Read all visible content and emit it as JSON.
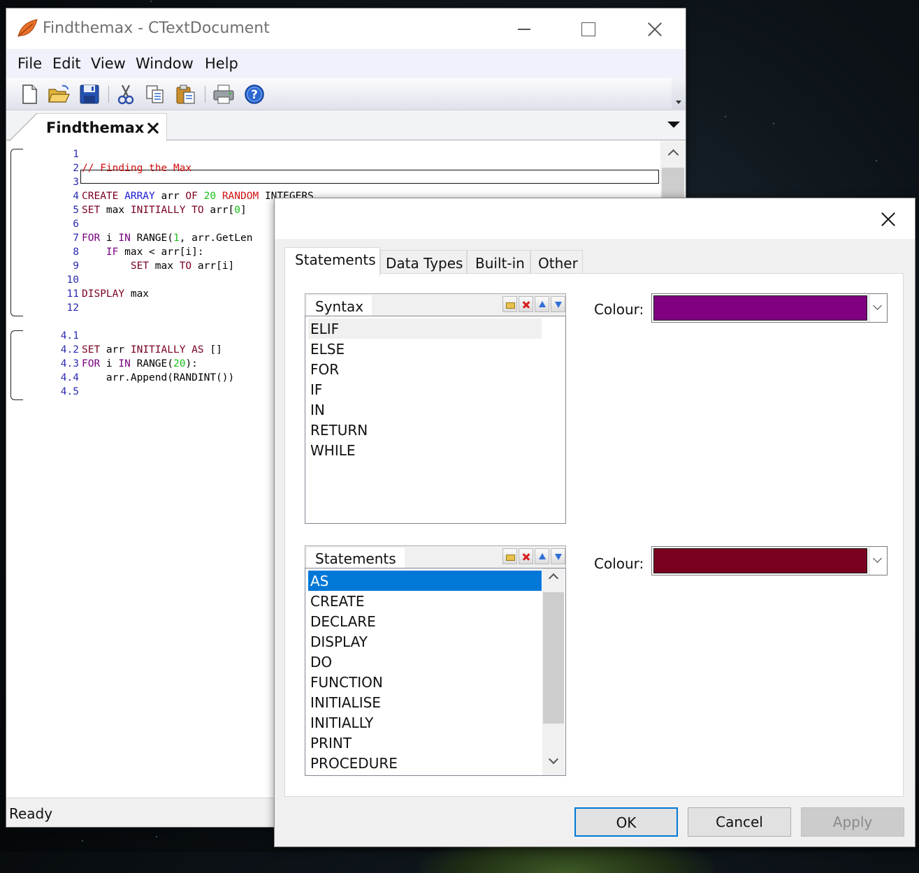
{
  "main_window": {
    "title": "Findthemax - CTextDocument",
    "menu": [
      "File",
      "Edit",
      "View",
      "Window",
      "Help"
    ],
    "toolbar_icons": [
      "new-file-icon",
      "open-folder-icon",
      "save-icon",
      "cut-icon",
      "copy-icon",
      "paste-icon",
      "print-icon",
      "help-icon"
    ],
    "document_tab": "Findthemax",
    "status": "Ready"
  },
  "editor": {
    "lines": [
      {
        "num": "1",
        "segments": []
      },
      {
        "num": "2",
        "segments": [
          {
            "t": "// Finding the Max",
            "c": "#d01010"
          }
        ]
      },
      {
        "num": "3",
        "segments": []
      },
      {
        "num": "4",
        "segments": [
          {
            "t": "CREATE ",
            "c": "#7a0020"
          },
          {
            "t": "ARRAY",
            "c": "#1a1ad6"
          },
          {
            "t": " arr ",
            "c": "#000000"
          },
          {
            "t": "OF",
            "c": "#7a0020"
          },
          {
            "t": " ",
            "c": "#000000"
          },
          {
            "t": "20",
            "c": "#18c018"
          },
          {
            "t": " ",
            "c": "#000000"
          },
          {
            "t": "RANDOM",
            "c": "#d01010"
          },
          {
            "t": " INTEGERS",
            "c": "#000000"
          }
        ]
      },
      {
        "num": "5",
        "segments": [
          {
            "t": "SET",
            "c": "#7a0020"
          },
          {
            "t": " max ",
            "c": "#000000"
          },
          {
            "t": "INITIALLY",
            "c": "#7a0020"
          },
          {
            "t": " ",
            "c": "#000000"
          },
          {
            "t": "TO",
            "c": "#7a0020"
          },
          {
            "t": " arr[",
            "c": "#000000"
          },
          {
            "t": "0",
            "c": "#18c018"
          },
          {
            "t": "]",
            "c": "#000000"
          }
        ]
      },
      {
        "num": "6",
        "segments": []
      },
      {
        "num": "7",
        "segments": [
          {
            "t": "FOR",
            "c": "#7a0080"
          },
          {
            "t": " i ",
            "c": "#000000"
          },
          {
            "t": "IN",
            "c": "#7a0080"
          },
          {
            "t": " RANGE(",
            "c": "#000000"
          },
          {
            "t": "1",
            "c": "#18c018"
          },
          {
            "t": ", arr.GetLen",
            "c": "#000000"
          }
        ]
      },
      {
        "num": "8",
        "segments": [
          {
            "t": "    ",
            "c": "#000000"
          },
          {
            "t": "IF",
            "c": "#7a0080"
          },
          {
            "t": " max < arr[i]:",
            "c": "#000000"
          }
        ]
      },
      {
        "num": "9",
        "segments": [
          {
            "t": "        ",
            "c": "#000000"
          },
          {
            "t": "SET",
            "c": "#7a0020"
          },
          {
            "t": " max ",
            "c": "#000000"
          },
          {
            "t": "TO",
            "c": "#7a0020"
          },
          {
            "t": " arr[i]",
            "c": "#000000"
          }
        ]
      },
      {
        "num": "10",
        "segments": []
      },
      {
        "num": "11",
        "segments": [
          {
            "t": "DISPLAY",
            "c": "#7a0020"
          },
          {
            "t": " max",
            "c": "#000000"
          }
        ]
      },
      {
        "num": "12",
        "segments": []
      },
      {
        "num": "",
        "segments": []
      },
      {
        "num": "4.1",
        "segments": []
      },
      {
        "num": "4.2",
        "segments": [
          {
            "t": "SET",
            "c": "#7a0020"
          },
          {
            "t": " arr ",
            "c": "#000000"
          },
          {
            "t": "INITIALLY",
            "c": "#7a0020"
          },
          {
            "t": " ",
            "c": "#000000"
          },
          {
            "t": "AS",
            "c": "#7a0020"
          },
          {
            "t": " []",
            "c": "#000000"
          }
        ]
      },
      {
        "num": "4.3",
        "segments": [
          {
            "t": "FOR",
            "c": "#7a0080"
          },
          {
            "t": " i ",
            "c": "#000000"
          },
          {
            "t": "IN",
            "c": "#7a0080"
          },
          {
            "t": " RANGE(",
            "c": "#000000"
          },
          {
            "t": "20",
            "c": "#18c018"
          },
          {
            "t": "):",
            "c": "#000000"
          }
        ]
      },
      {
        "num": "4.4",
        "segments": [
          {
            "t": "    arr.Append(RANDINT())",
            "c": "#000000"
          }
        ]
      },
      {
        "num": "4.5",
        "segments": []
      }
    ]
  },
  "dialog": {
    "tabs": [
      "Statements",
      "Data Types",
      "Built-in",
      "Other"
    ],
    "active_tab": "Statements",
    "syntax_list": {
      "header": "Syntax",
      "items": [
        "ELIF",
        "ELSE",
        "FOR",
        "IF",
        "IN",
        "RETURN",
        "WHILE"
      ],
      "hovered": "ELIF",
      "colour_label": "Colour:",
      "colour": "#800080"
    },
    "statements_list": {
      "header": "Statements",
      "items": [
        "AS",
        "CREATE",
        "DECLARE",
        "DISPLAY",
        "DO",
        "FUNCTION",
        "INITIALISE",
        "INITIALLY",
        "PRINT",
        "PROCEDURE"
      ],
      "selected": "AS",
      "colour_label": "Colour:",
      "colour": "#7a0020"
    },
    "buttons": {
      "ok": "OK",
      "cancel": "Cancel",
      "apply": "Apply"
    }
  }
}
